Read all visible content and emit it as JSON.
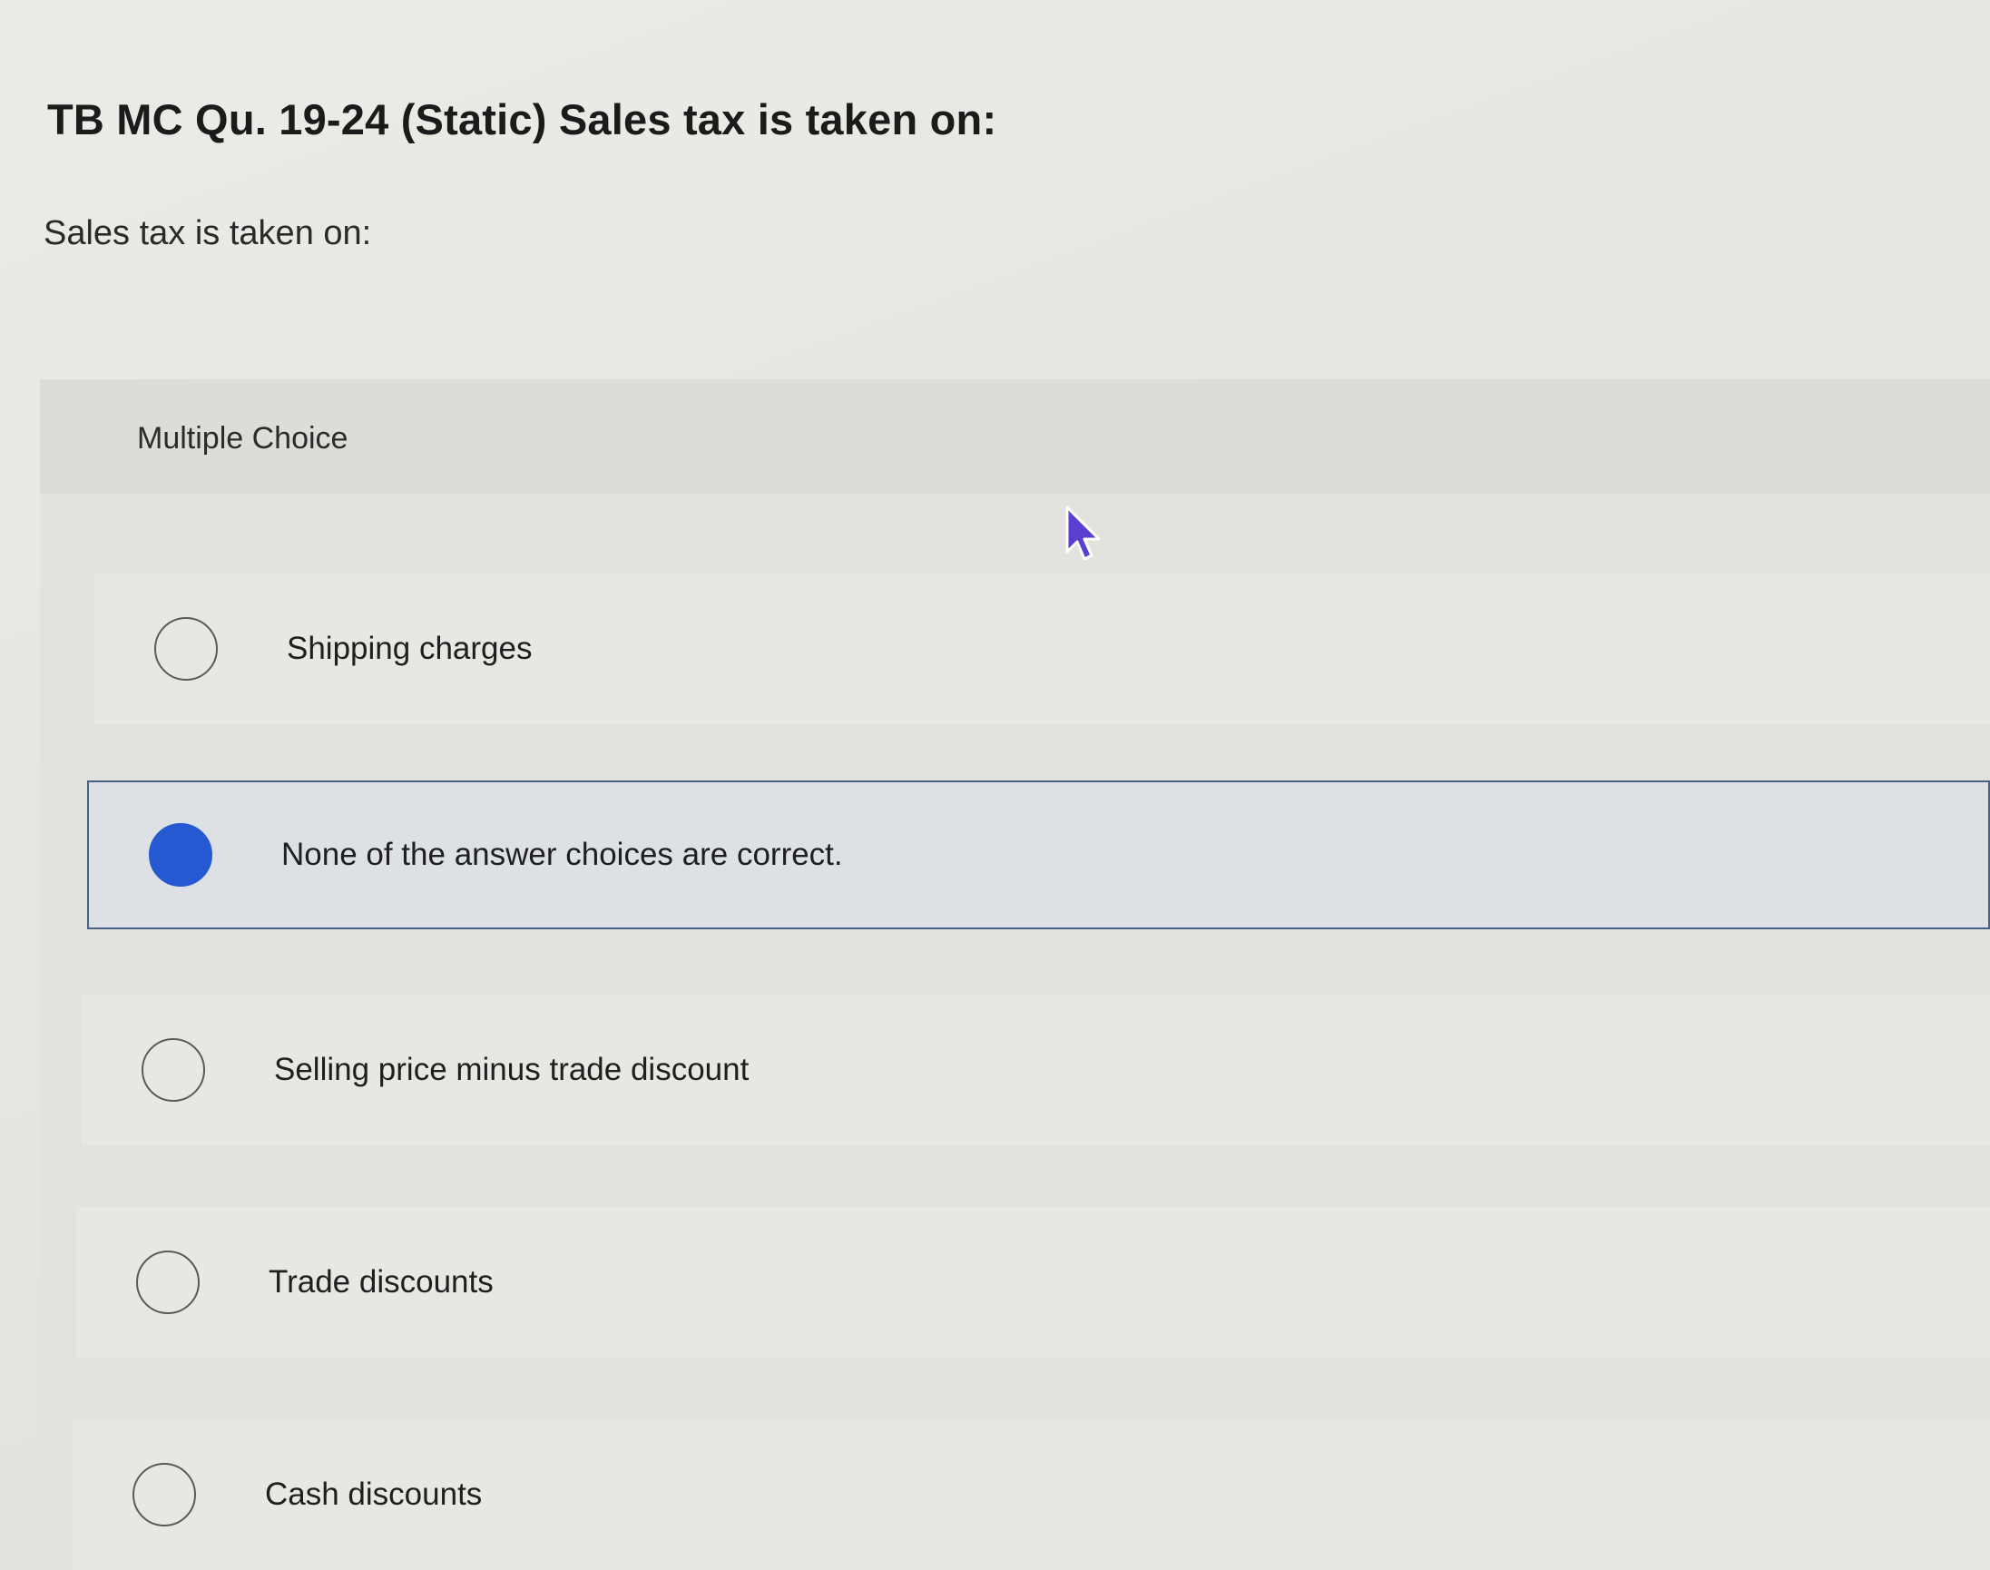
{
  "question": {
    "title": "TB MC Qu. 19-24 (Static) Sales tax is taken on:",
    "prompt": "Sales tax is taken on:"
  },
  "answer_panel": {
    "label": "Multiple Choice",
    "options": [
      {
        "label": "Shipping charges",
        "selected": false
      },
      {
        "label": "None of the answer choices are correct.",
        "selected": true
      },
      {
        "label": "Selling price minus trade discount",
        "selected": false
      },
      {
        "label": "Trade discounts",
        "selected": false
      },
      {
        "label": "Cash discounts",
        "selected": false
      }
    ]
  },
  "colors": {
    "selected_radio": "#2459d2",
    "selected_border": "#4a5f86",
    "cursor_fill": "#5a3fd0"
  },
  "icons": {
    "cursor": "mouse-pointer-icon"
  }
}
